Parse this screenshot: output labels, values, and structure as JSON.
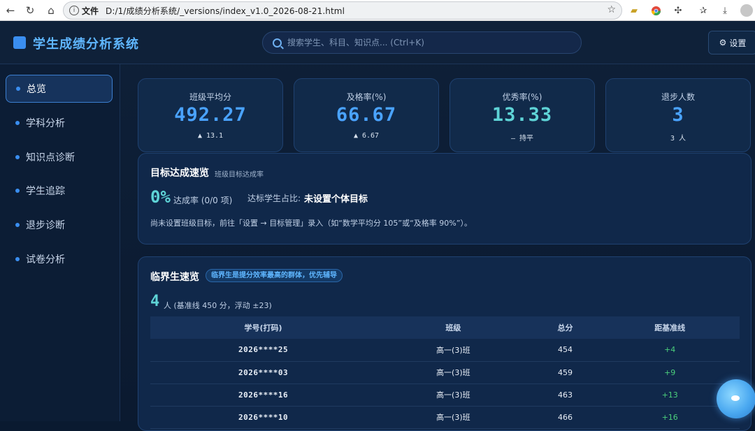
{
  "browser": {
    "file_label": "文件",
    "url": "D:/1/成绩分析系统/_versions/index_v1.0_2026-08-21.html"
  },
  "app": {
    "title": "学生成绩分析系统",
    "search_placeholder": "搜索学生、科目、知识点... (Ctrl+K)",
    "settings_label": "设置"
  },
  "sidebar": {
    "items": [
      {
        "label": "总览",
        "active": true
      },
      {
        "label": "学科分析"
      },
      {
        "label": "知识点诊断"
      },
      {
        "label": "学生追踪"
      },
      {
        "label": "退步诊断"
      },
      {
        "label": "试卷分析"
      }
    ]
  },
  "stats": [
    {
      "label": "班级平均分",
      "value": "492.27",
      "sub": "▲ 13.1"
    },
    {
      "label": "及格率(%)",
      "value": "66.67",
      "sub": "▲ 6.67"
    },
    {
      "label": "优秀率(%)",
      "value": "13.33",
      "sub": "— 持平"
    },
    {
      "label": "退步人数",
      "value": "3",
      "sub": "3 人"
    }
  ],
  "goal_panel": {
    "title": "目标达成速览",
    "hint": "班级目标达成率",
    "rate_value": "0%",
    "rate_text": "达成率 (0/0 项)",
    "share_label": "达标学生占比:",
    "share_value": "未设置个体目标",
    "description": "尚未设置班级目标，前往「设置 → 目标管理」录入（如“数学平均分 105”或“及格率 90%”）。"
  },
  "borderline_panel": {
    "title": "临界生速览",
    "badge": "临界生是提分效率最高的群体，优先辅导",
    "count": "4",
    "count_text": "人 (基准线 450 分，浮动 ±23)",
    "columns": [
      "学号(打码)",
      "班级",
      "总分",
      "距基准线"
    ],
    "rows": [
      [
        "2026****25",
        "高一(3)班",
        "454",
        "+4"
      ],
      [
        "2026****03",
        "高一(3)班",
        "459",
        "+9"
      ],
      [
        "2026****16",
        "高一(3)班",
        "463",
        "+13"
      ],
      [
        "2026****10",
        "高一(3)班",
        "466",
        "+16"
      ]
    ]
  },
  "colors": {
    "accent": "#4aa3ff",
    "teal": "#5ed3d6",
    "positive": "#4bd07c",
    "background": "#0b1a30"
  }
}
